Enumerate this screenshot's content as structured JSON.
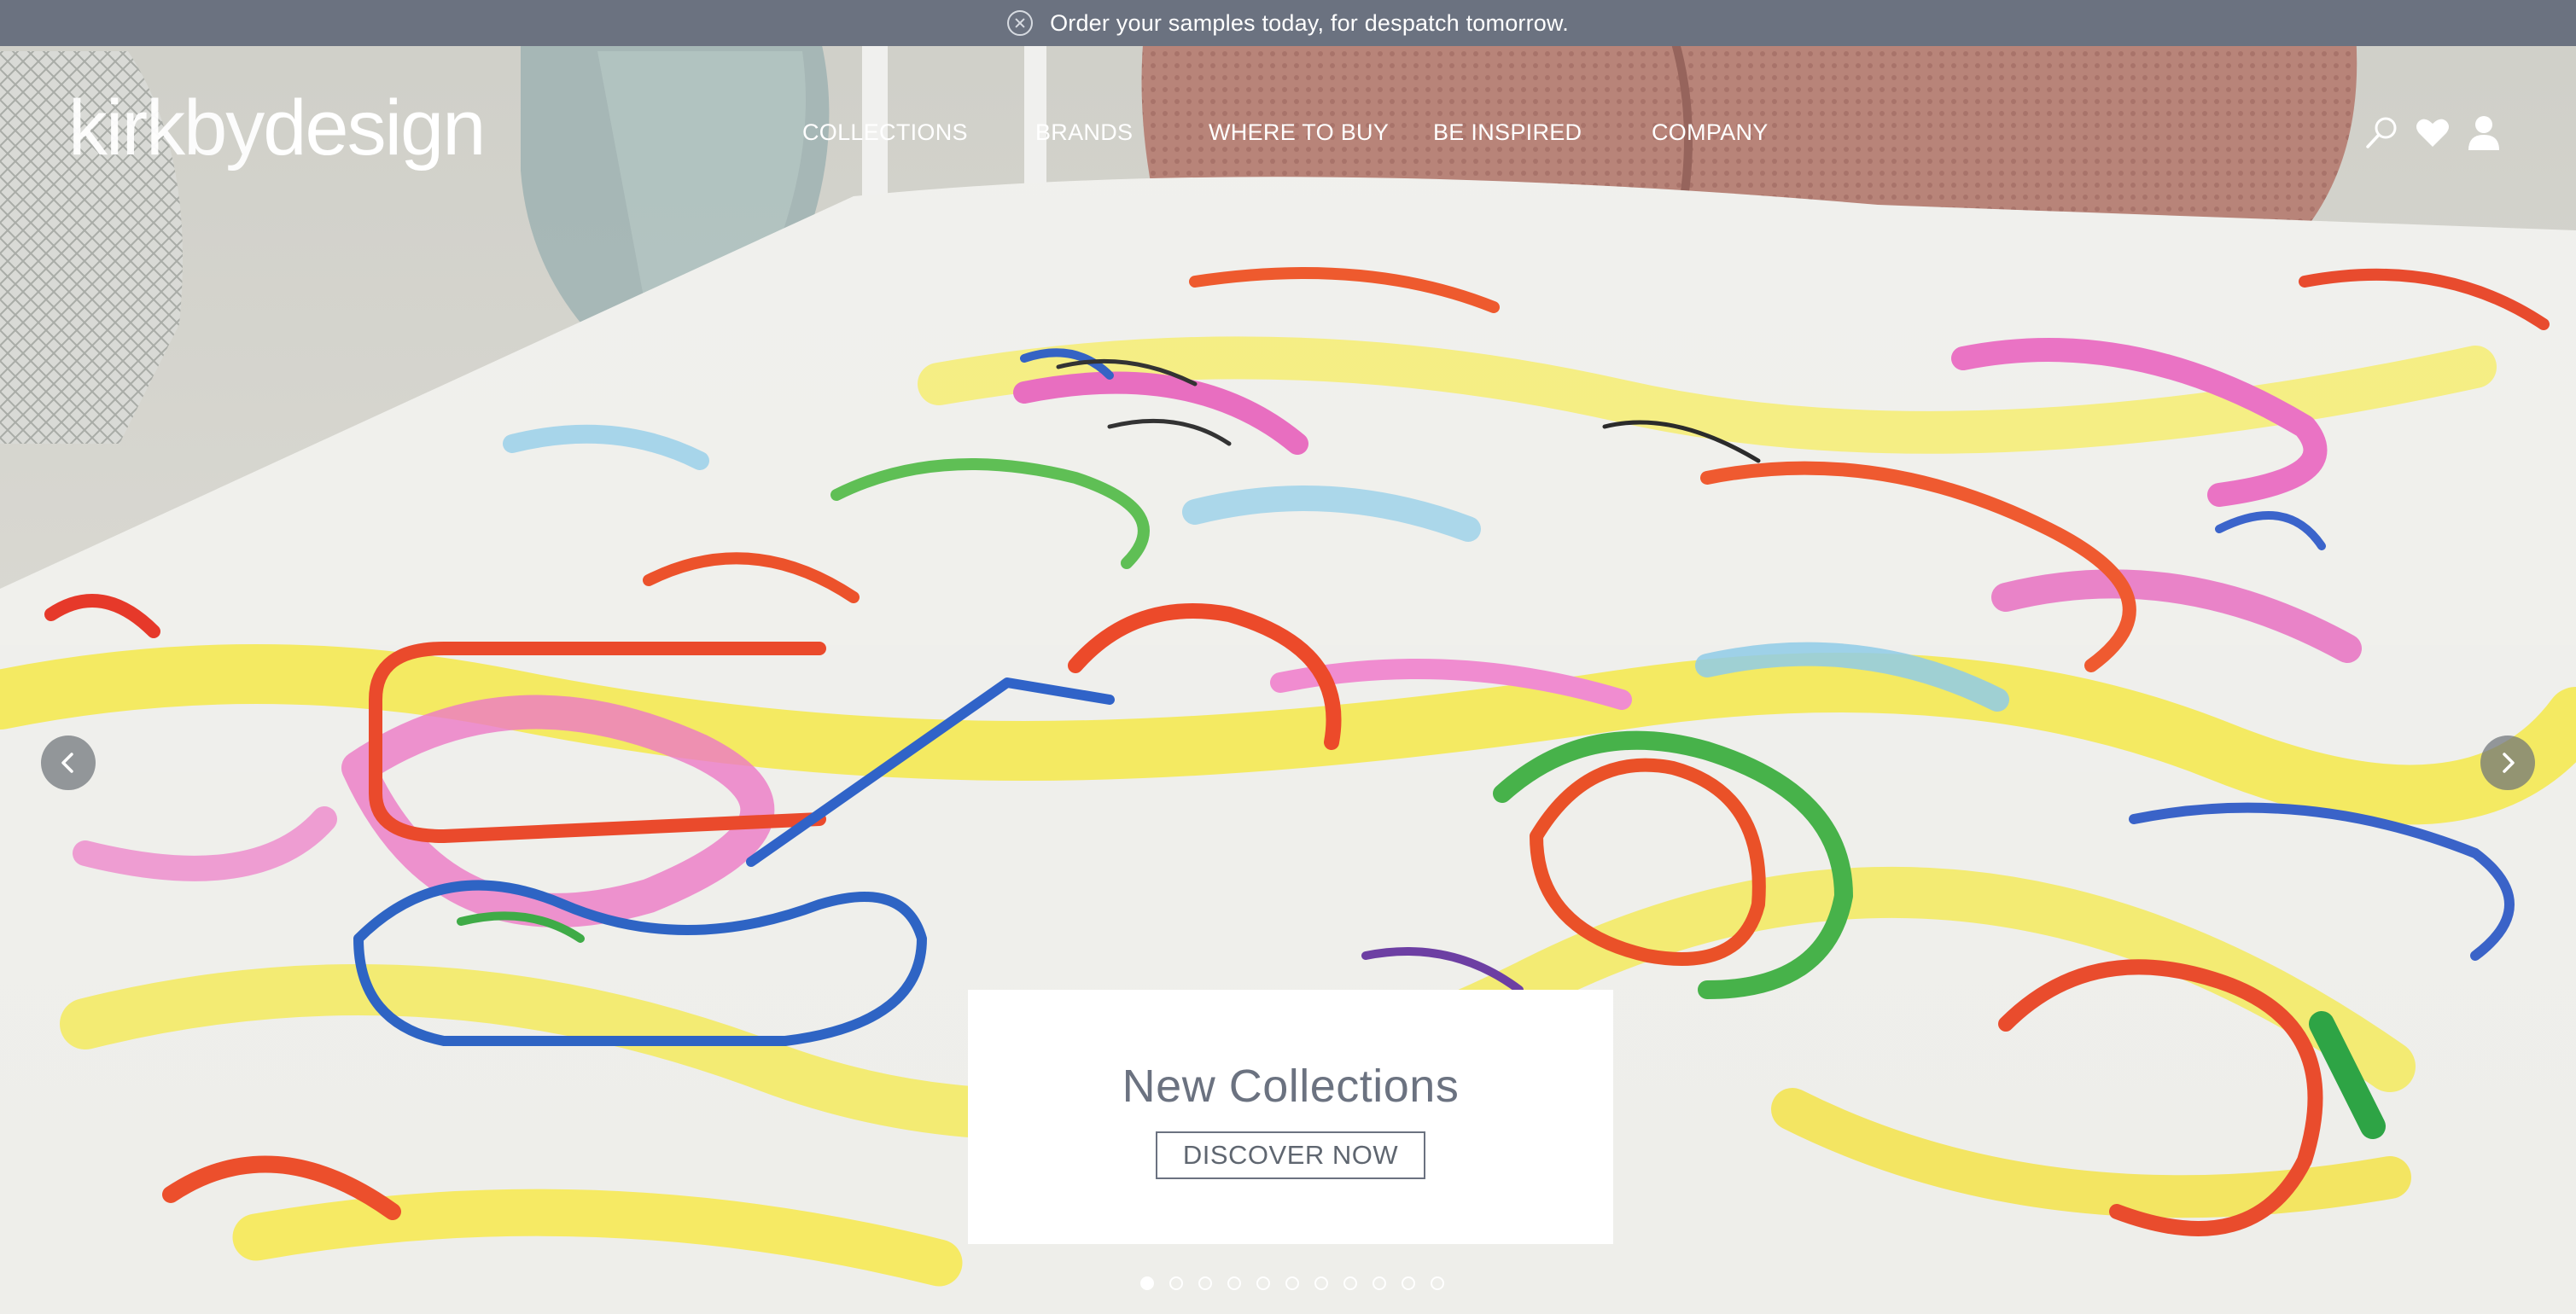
{
  "announcement": {
    "text": "Order your samples today, for despatch tomorrow."
  },
  "brand": {
    "logo_light": "kirkby",
    "logo_bold": "design"
  },
  "nav": {
    "items": [
      {
        "label": "COLLECTIONS"
      },
      {
        "label": "BRANDS"
      },
      {
        "label": "WHERE TO BUY"
      },
      {
        "label": "BE INSPIRED"
      },
      {
        "label": "COMPANY"
      }
    ]
  },
  "header_icons": [
    "search-icon",
    "heart-icon",
    "user-icon"
  ],
  "promo": {
    "title": "New Collections",
    "button": "DISCOVER NOW"
  },
  "carousel": {
    "slide_count": 11,
    "active_slide": 1
  },
  "colors": {
    "announce_bar": "#6b7280",
    "promo_text": "#6b7280",
    "white": "#ffffff"
  }
}
